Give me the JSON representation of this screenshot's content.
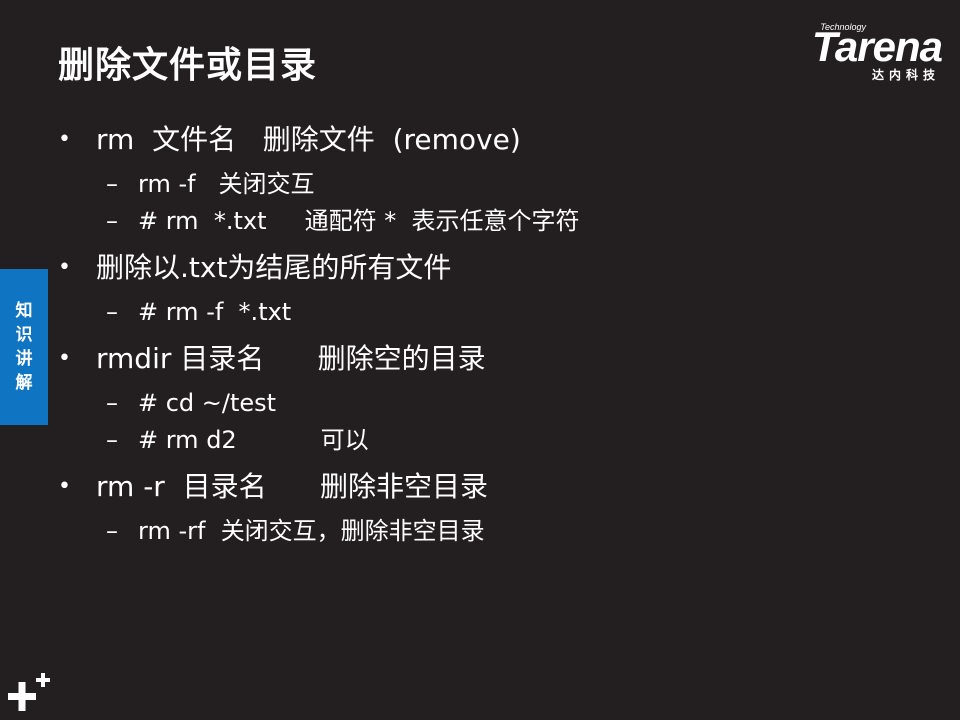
{
  "slide": {
    "title": "删除文件或目录",
    "logo": {
      "tagline": "Technology",
      "wordmark": "Tarena",
      "subtitle": "达内科技"
    },
    "side_tab": [
      "知",
      "识",
      "讲",
      "解"
    ],
    "bullet_symbol": "•",
    "dash_symbol": "–",
    "items": [
      {
        "text": "rm  文件名   删除文件  (remove)",
        "subs": [
          "rm -f   关闭交互",
          "# rm  *.txt     通配符 *  表示任意个字符"
        ]
      },
      {
        "text": "删除以.txt为结尾的所有文件",
        "subs": [
          "# rm -f  *.txt"
        ]
      },
      {
        "text": "rmdir 目录名      删除空的目录",
        "subs": [
          "# cd ~/test",
          "# rm d2           可以"
        ]
      },
      {
        "text": "rm -r  目录名      删除非空目录",
        "subs": [
          "rm -rf  关闭交互，删除非空目录"
        ]
      }
    ]
  },
  "colors": {
    "background": "#231f20",
    "accent": "#0f75c2",
    "text": "#ffffff"
  },
  "icons": {
    "corner_mark": "plus-icon"
  }
}
